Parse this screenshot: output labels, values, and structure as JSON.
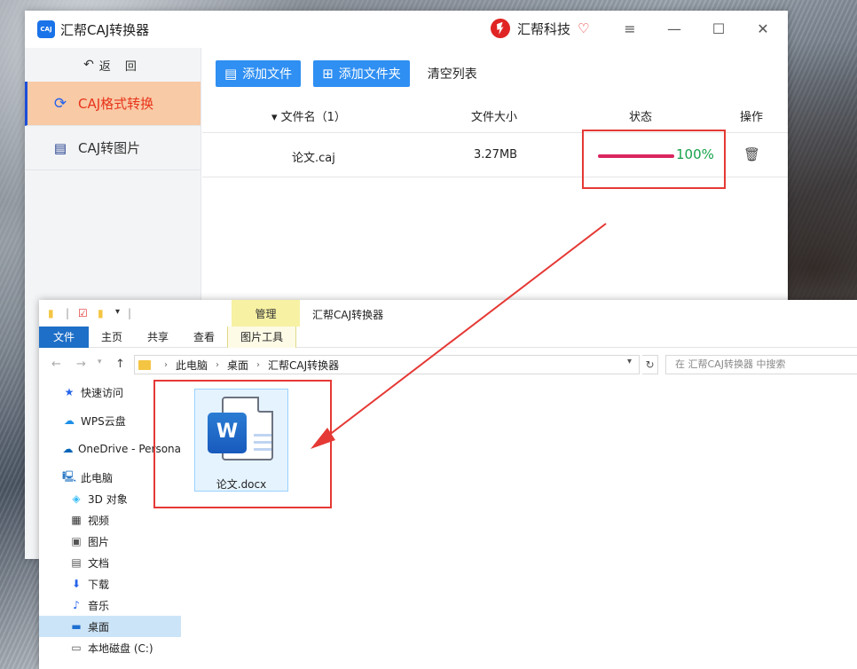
{
  "app": {
    "title": "汇帮CAJ转换器",
    "logo_text": "CAJ",
    "brand_name": "汇帮科技",
    "window_controls": [
      "≡",
      "—",
      "☐",
      "✕"
    ]
  },
  "sidebar": {
    "back_label": "返 回",
    "items": [
      {
        "label": "CAJ格式转换",
        "active": true
      },
      {
        "label": "CAJ转图片",
        "active": false
      }
    ]
  },
  "toolbar": {
    "add_file": "添加文件",
    "add_folder": "添加文件夹",
    "clear_list": "清空列表"
  },
  "table": {
    "headers": {
      "name": "▾ 文件名（1）",
      "size": "文件大小",
      "status": "状态",
      "action": "操作"
    },
    "rows": [
      {
        "name": "论文.caj",
        "size": "3.27MB",
        "progress": 1.0,
        "percent": "100%"
      }
    ]
  },
  "explorer": {
    "context_tab": "管理",
    "window_title": "汇帮CAJ转换器",
    "ribbon_tabs": [
      "文件",
      "主页",
      "共享",
      "查看",
      "图片工具"
    ],
    "breadcrumb": [
      "此电脑",
      "桌面",
      "汇帮CAJ转换器"
    ],
    "search_placeholder": "在 汇帮CAJ转换器 中搜索",
    "nav_items": [
      "快速访问",
      "WPS云盘",
      "OneDrive - Persona",
      "此电脑",
      "3D 对象",
      "视频",
      "图片",
      "文档",
      "下载",
      "音乐",
      "桌面",
      "本地磁盘 (C:)"
    ],
    "files": [
      {
        "name": "论文.docx",
        "badge": "W"
      }
    ]
  },
  "colors": {
    "accent_blue": "#2f8ff2",
    "active_bg": "#f8caa6",
    "active_text": "#e8341b",
    "progress": "#d9265f",
    "percent_green": "#16a34a",
    "annotation_red": "#e53935"
  }
}
